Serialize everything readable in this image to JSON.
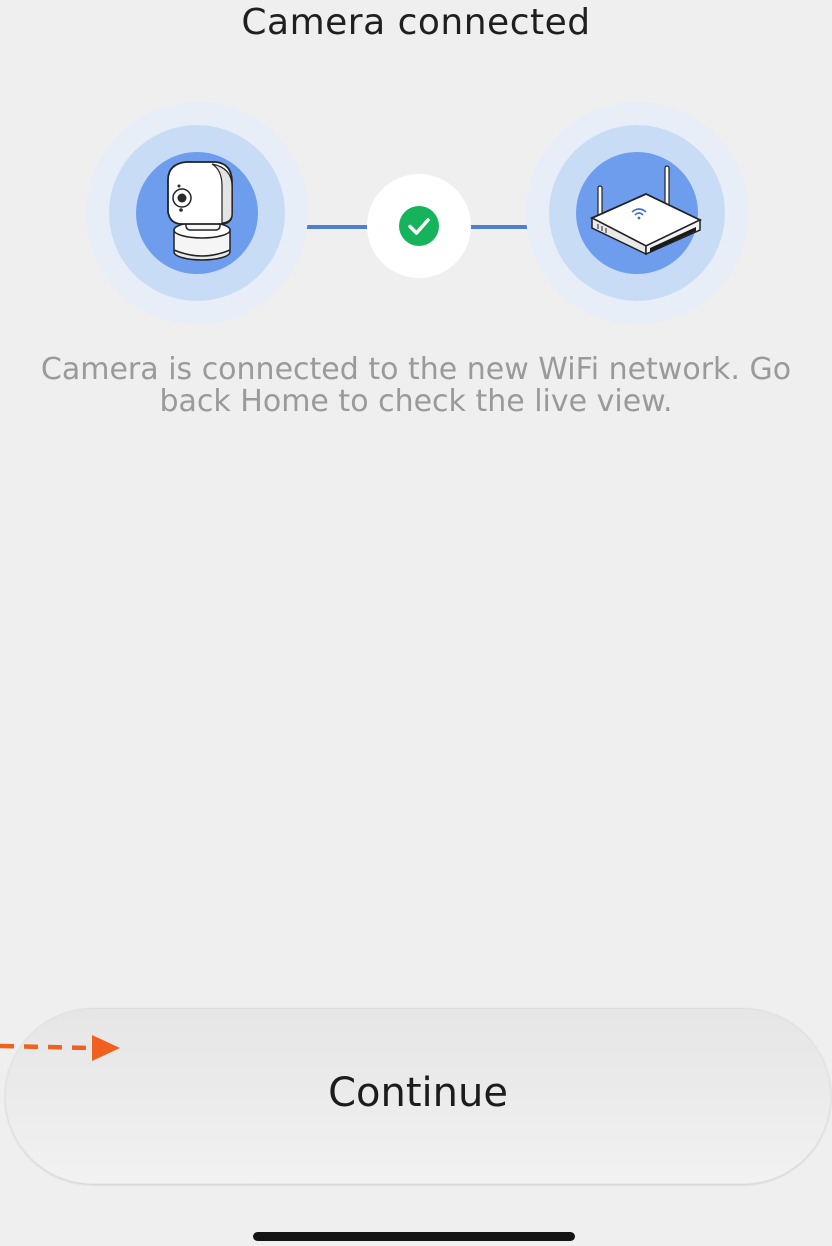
{
  "page": {
    "title": "Camera connected",
    "message": "Camera is connected to the new WiFi network. Go back Home to check the live view."
  },
  "connection": {
    "left_device_icon": "security-camera-icon",
    "right_device_icon": "wifi-router-icon",
    "status_icon": "check-circle-icon",
    "status_color": "#16b45a",
    "link_color": "#4f7fd1",
    "halo_color": "#6e9ded"
  },
  "actions": {
    "continue_label": "Continue"
  },
  "overlay": {
    "pointer_icon": "dashed-arrow-icon",
    "pointer_color": "#f0601e"
  }
}
